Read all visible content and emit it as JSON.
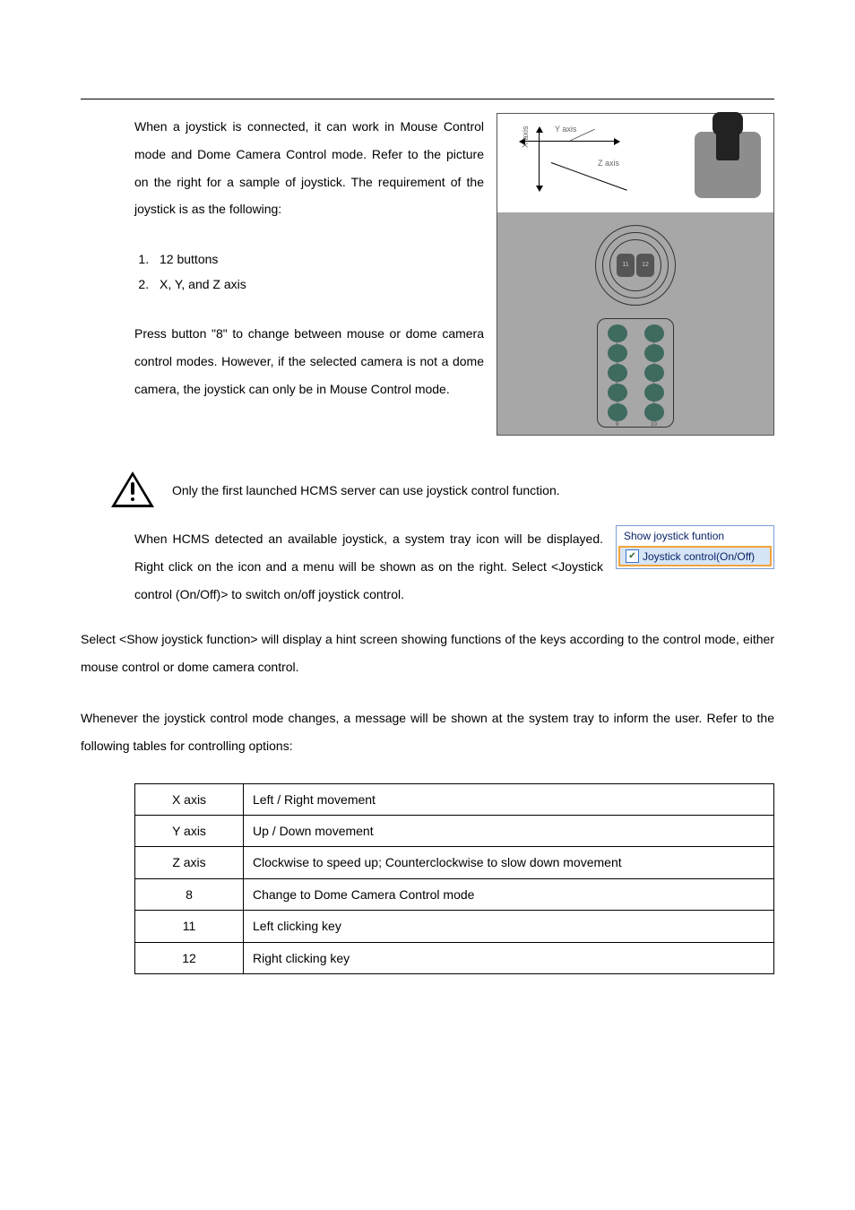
{
  "intro": {
    "p1": "When a joystick is connected, it can work in Mouse Control mode and Dome Camera Control mode. Refer to the picture on the right for a sample of joystick. The requirement of the joystick is as the following:",
    "list": {
      "i1": "12 buttons",
      "i2": "X, Y, and Z axis"
    },
    "p2": "Press button \"8\" to change between mouse or dome camera control modes. However, if the selected camera is not a dome camera, the joystick can only be in Mouse Control mode."
  },
  "diagram": {
    "yaxis": "Y axis",
    "xaxis": "X axis",
    "zaxis": "Z axis",
    "b11": "11",
    "b12": "12",
    "k": [
      "1",
      "2",
      "3",
      "4",
      "5",
      "6",
      "7",
      "8",
      "9",
      "10"
    ]
  },
  "note": "Only the first launched HCMS server can use joystick control function.",
  "tray_para": "When HCMS detected an available joystick, a system tray icon will be displayed. Right click on the icon and a menu will be shown as on the right. Select <Joystick control (On/Off)> to switch on/off joystick control.",
  "tray_menu": {
    "item1": "Show joystick funtion",
    "item2": "Joystick control(On/Off)"
  },
  "para3": "Select <Show joystick function> will display a hint screen showing functions of the keys according to the control mode, either mouse control or dome camera control.",
  "para4": "Whenever the joystick control mode changes, a message will be shown at the system tray to inform the user. Refer to the following tables for controlling options:",
  "table": {
    "r1": {
      "k": "X axis",
      "v": "Left / Right movement"
    },
    "r2": {
      "k": "Y axis",
      "v": "Up / Down movement"
    },
    "r3": {
      "k": "Z axis",
      "v": "Clockwise to speed up; Counterclockwise to slow down movement"
    },
    "r4": {
      "k": "8",
      "v": "Change to Dome Camera Control mode"
    },
    "r5": {
      "k": "11",
      "v": "Left clicking key"
    },
    "r6": {
      "k": "12",
      "v": "Right clicking key"
    }
  }
}
